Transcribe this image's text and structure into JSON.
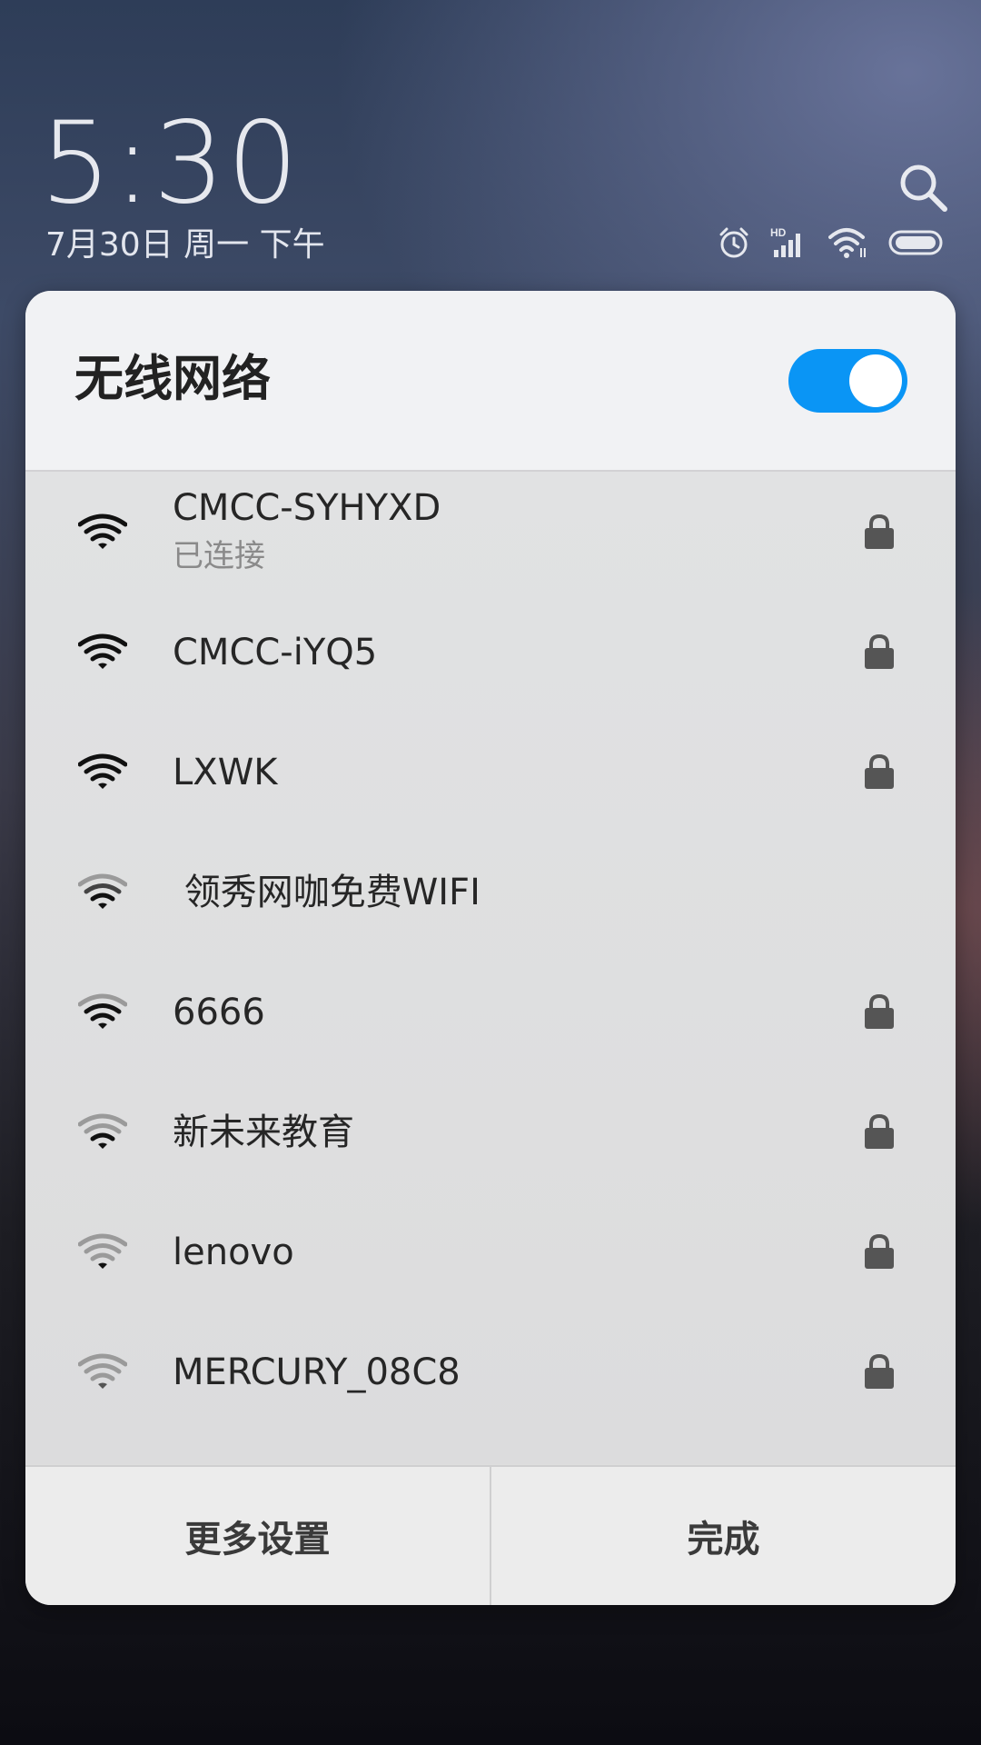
{
  "status": {
    "time": "5:30",
    "date": "7月30日 周一 下午",
    "hd_label": "HD"
  },
  "panel": {
    "title": "无线网络",
    "wifi_enabled": true,
    "networks": [
      {
        "name": "CMCC-SYHYXD",
        "status": "已连接",
        "secured": true,
        "signal": "full"
      },
      {
        "name": "CMCC-iYQ5",
        "status": "",
        "secured": true,
        "signal": "full"
      },
      {
        "name": "LXWK",
        "status": "",
        "secured": true,
        "signal": "full"
      },
      {
        "name": " 领秀网咖免费WIFI",
        "status": "",
        "secured": false,
        "signal": "medium"
      },
      {
        "name": "6666",
        "status": "",
        "secured": true,
        "signal": "medium-high"
      },
      {
        "name": "新未来教育",
        "status": "",
        "secured": true,
        "signal": "medium"
      },
      {
        "name": "lenovo",
        "status": "",
        "secured": true,
        "signal": "low"
      },
      {
        "name": "MERCURY_08C8",
        "status": "",
        "secured": true,
        "signal": "low"
      }
    ],
    "footer": {
      "more_settings": "更多设置",
      "done": "完成"
    }
  },
  "colors": {
    "toggle_on": "#0a95f5",
    "wifi_strong": "#111111",
    "wifi_weak": "#9a9a9a",
    "lock": "#555555"
  }
}
